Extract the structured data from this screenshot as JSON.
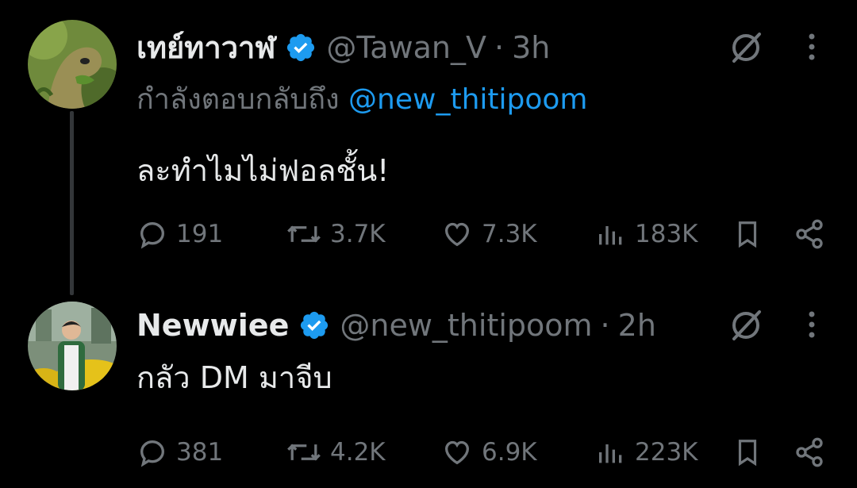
{
  "tweets": [
    {
      "author_name": "เทย์ทาวาฬ",
      "handle": "@Tawan_V",
      "separator": "·",
      "time": "3h",
      "replying_prefix": "กำลังตอบกลับถึง",
      "replying_mention": "@new_thitipoom",
      "text": "ละทำไมไม่ฟอลชั้น!",
      "replies": "191",
      "reposts": "3.7K",
      "likes": "7.3K",
      "views": "183K"
    },
    {
      "author_name": "Newwiee",
      "handle": "@new_thitipoom",
      "separator": "·",
      "time": "2h",
      "text": "กลัว DM มาจีบ",
      "replies": "381",
      "reposts": "4.2K",
      "likes": "6.9K",
      "views": "223K"
    }
  ],
  "colors": {
    "background": "#000000",
    "text": "#e7e9ea",
    "muted": "#71767b",
    "accent": "#1d9bf0",
    "thread_line": "#333639"
  },
  "icons": [
    "verified-badge-icon",
    "grok-icon",
    "more-icon",
    "reply-icon",
    "repost-icon",
    "like-icon",
    "views-icon",
    "bookmark-icon",
    "share-icon"
  ]
}
